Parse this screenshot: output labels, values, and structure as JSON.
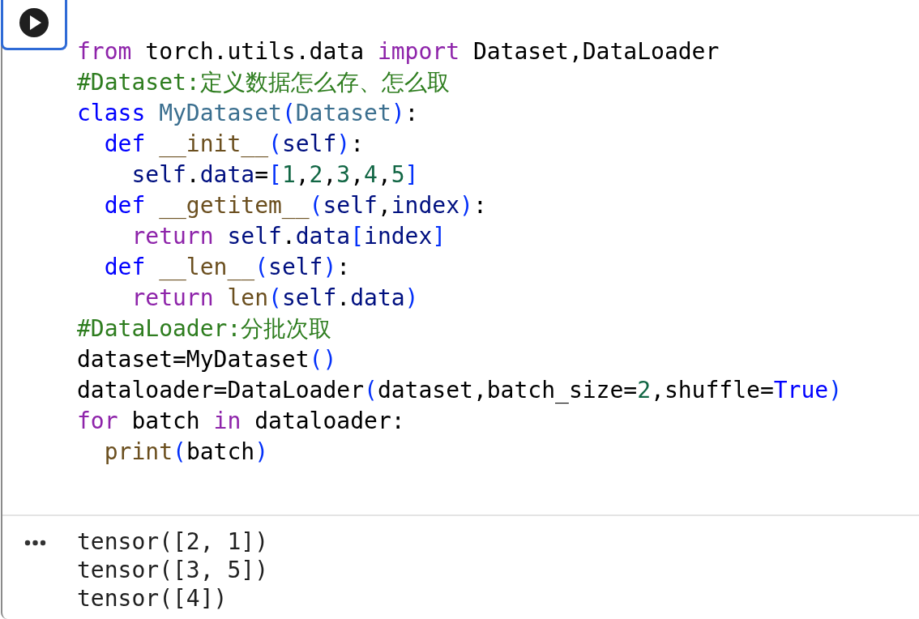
{
  "cell": {
    "code_lines": [
      [
        {
          "kind": "keyword",
          "text": "from"
        },
        {
          "kind": "plain",
          "text": " torch.utils.data "
        },
        {
          "kind": "keyword",
          "text": "import"
        },
        {
          "kind": "plain",
          "text": " Dataset,DataLoader"
        }
      ],
      [
        {
          "kind": "comment",
          "text": "#Dataset:定义数据怎么存、怎么取"
        }
      ],
      [
        {
          "kind": "def",
          "text": "class "
        },
        {
          "kind": "class",
          "text": "MyDataset"
        },
        {
          "kind": "paren",
          "text": "("
        },
        {
          "kind": "class",
          "text": "Dataset"
        },
        {
          "kind": "paren",
          "text": ")"
        },
        {
          "kind": "plain",
          "text": ":"
        }
      ],
      [
        {
          "kind": "def",
          "text": "  def "
        },
        {
          "kind": "func",
          "text": "__init__"
        },
        {
          "kind": "paren",
          "text": "("
        },
        {
          "kind": "var",
          "text": "self"
        },
        {
          "kind": "paren",
          "text": ")"
        },
        {
          "kind": "plain",
          "text": ":"
        }
      ],
      [
        {
          "kind": "var",
          "text": "    self"
        },
        {
          "kind": "plain",
          "text": "."
        },
        {
          "kind": "var",
          "text": "data"
        },
        {
          "kind": "plain",
          "text": "="
        },
        {
          "kind": "paren",
          "text": "["
        },
        {
          "kind": "number",
          "text": "1"
        },
        {
          "kind": "plain",
          "text": ","
        },
        {
          "kind": "number",
          "text": "2"
        },
        {
          "kind": "plain",
          "text": ","
        },
        {
          "kind": "number",
          "text": "3"
        },
        {
          "kind": "plain",
          "text": ","
        },
        {
          "kind": "number",
          "text": "4"
        },
        {
          "kind": "plain",
          "text": ","
        },
        {
          "kind": "number",
          "text": "5"
        },
        {
          "kind": "paren",
          "text": "]"
        }
      ],
      [
        {
          "kind": "def",
          "text": "  def "
        },
        {
          "kind": "func",
          "text": "__getitem__"
        },
        {
          "kind": "paren",
          "text": "("
        },
        {
          "kind": "var",
          "text": "self"
        },
        {
          "kind": "plain",
          "text": ","
        },
        {
          "kind": "var",
          "text": "index"
        },
        {
          "kind": "paren",
          "text": ")"
        },
        {
          "kind": "plain",
          "text": ":"
        }
      ],
      [
        {
          "kind": "keyword",
          "text": "    return "
        },
        {
          "kind": "var",
          "text": "self"
        },
        {
          "kind": "plain",
          "text": "."
        },
        {
          "kind": "var",
          "text": "data"
        },
        {
          "kind": "paren",
          "text": "["
        },
        {
          "kind": "var",
          "text": "index"
        },
        {
          "kind": "paren",
          "text": "]"
        }
      ],
      [
        {
          "kind": "def",
          "text": "  def "
        },
        {
          "kind": "func",
          "text": "__len__"
        },
        {
          "kind": "paren",
          "text": "("
        },
        {
          "kind": "var",
          "text": "self"
        },
        {
          "kind": "paren",
          "text": ")"
        },
        {
          "kind": "plain",
          "text": ":"
        }
      ],
      [
        {
          "kind": "keyword",
          "text": "    return "
        },
        {
          "kind": "func",
          "text": "len"
        },
        {
          "kind": "paren",
          "text": "("
        },
        {
          "kind": "var",
          "text": "self"
        },
        {
          "kind": "plain",
          "text": "."
        },
        {
          "kind": "var",
          "text": "data"
        },
        {
          "kind": "paren",
          "text": ")"
        }
      ],
      [
        {
          "kind": "comment",
          "text": "#DataLoader:分批次取"
        }
      ],
      [
        {
          "kind": "plain",
          "text": "dataset=MyDataset"
        },
        {
          "kind": "paren",
          "text": "()"
        }
      ],
      [
        {
          "kind": "plain",
          "text": "dataloader=DataLoader"
        },
        {
          "kind": "paren",
          "text": "("
        },
        {
          "kind": "plain",
          "text": "dataset,batch_size="
        },
        {
          "kind": "number",
          "text": "2"
        },
        {
          "kind": "plain",
          "text": ",shuffle="
        },
        {
          "kind": "def",
          "text": "True"
        },
        {
          "kind": "paren",
          "text": ")"
        }
      ],
      [
        {
          "kind": "keyword",
          "text": "for"
        },
        {
          "kind": "plain",
          "text": " batch "
        },
        {
          "kind": "keyword",
          "text": "in"
        },
        {
          "kind": "plain",
          "text": " dataloader:"
        }
      ],
      [
        {
          "kind": "func",
          "text": "  print"
        },
        {
          "kind": "paren",
          "text": "("
        },
        {
          "kind": "plain",
          "text": "batch"
        },
        {
          "kind": "paren",
          "text": ")"
        }
      ]
    ],
    "output_lines": [
      "tensor([2, 1])",
      "tensor([3, 5])",
      "tensor([4])"
    ]
  }
}
